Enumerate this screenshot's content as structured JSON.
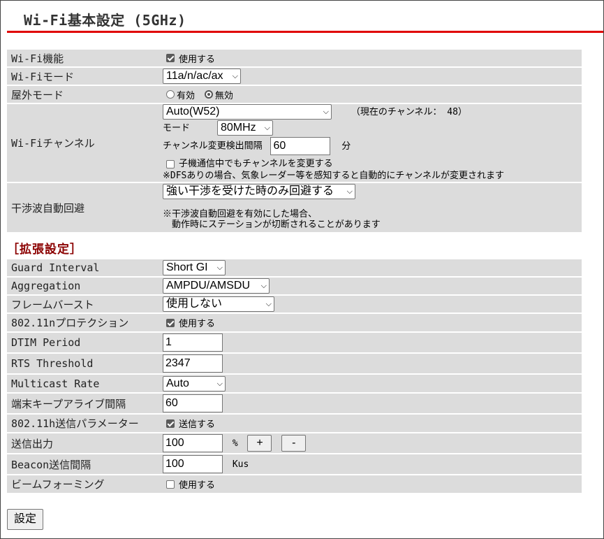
{
  "page": {
    "title": "Wi-Fi基本設定 (5GHz)"
  },
  "basic": {
    "wifi_function": {
      "label": "Wi-Fi機能",
      "checked": true,
      "option": "使用する"
    },
    "wifi_mode": {
      "label": "Wi-Fiモード",
      "value": "11a/n/ac/ax"
    },
    "outdoor_mode": {
      "label": "屋外モード",
      "opt_enable": "有効",
      "opt_disable": "無効",
      "selected": "無効"
    },
    "wifi_channel": {
      "label": "Wi-Fiチャンネル",
      "channel_value": "Auto(W52)",
      "current_channel_text": "（現在のチャンネル： 48）",
      "mode_label": "モード",
      "mode_value": "80MHz",
      "detect_interval_label": "チャンネル変更検出間隔",
      "detect_interval_value": "60",
      "detect_interval_unit": "分",
      "change_during_child_label": "子機通信中でもチャンネルを変更する",
      "change_during_child_checked": false,
      "dfs_note": "※DFSありの場合、気象レーダー等を感知すると自動的にチャンネルが変更されます"
    },
    "interference": {
      "label": "干渉波自動回避",
      "value": "強い干渉を受けた時のみ回避する",
      "note_line1": "※干渉波自動回避を有効にした場合、",
      "note_line2": "　動作時にステーションが切断されることがあります"
    }
  },
  "extended": {
    "section_title": "［拡張設定］",
    "guard_interval": {
      "label": "Guard Interval",
      "value": "Short GI"
    },
    "aggregation": {
      "label": "Aggregation",
      "value": "AMPDU/AMSDU"
    },
    "frame_burst": {
      "label": "フレームバースト",
      "value": "使用しない"
    },
    "protection_11n": {
      "label": "802.11nプロテクション",
      "checked": true,
      "option": "使用する"
    },
    "dtim_period": {
      "label": "DTIM Period",
      "value": "1"
    },
    "rts_threshold": {
      "label": "RTS Threshold",
      "value": "2347"
    },
    "multicast_rate": {
      "label": "Multicast Rate",
      "value": "Auto"
    },
    "keepalive": {
      "label": "端末キープアライブ間隔",
      "value": "60"
    },
    "tx_param_11h": {
      "label": "802.11h送信パラメーター",
      "checked": true,
      "option": "送信する"
    },
    "tx_power": {
      "label": "送信出力",
      "value": "100",
      "unit": "%",
      "plus": "+",
      "minus": "-"
    },
    "beacon_interval": {
      "label": "Beacon送信間隔",
      "value": "100",
      "unit": "Kus"
    },
    "beamforming": {
      "label": "ビームフォーミング",
      "checked": false,
      "option": "使用する"
    }
  },
  "actions": {
    "submit_label": "設定"
  }
}
